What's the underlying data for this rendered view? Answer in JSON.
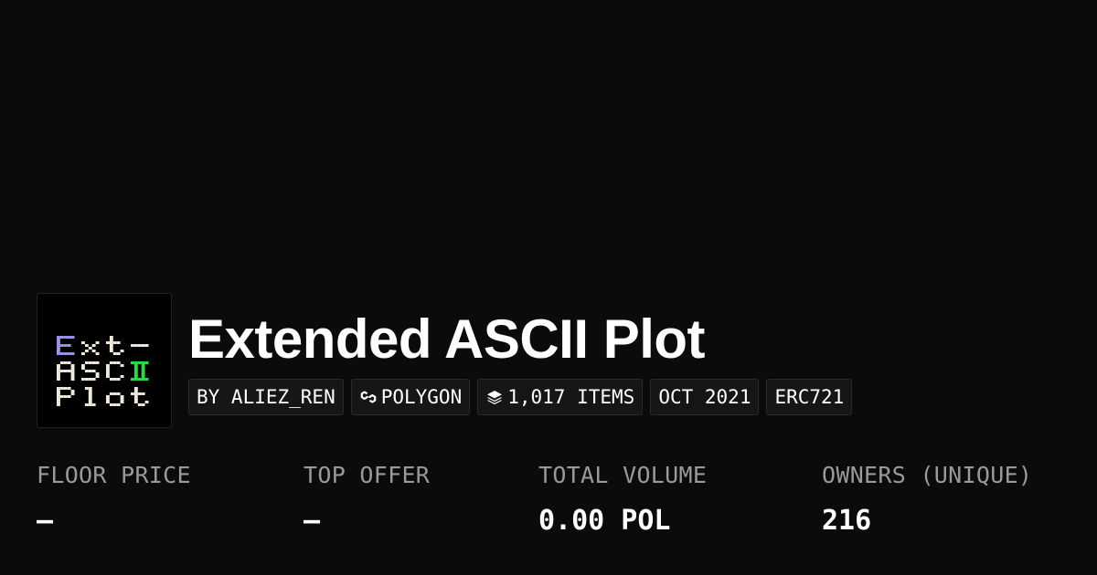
{
  "colors": {
    "background": "#0b0b0b",
    "chip_background": "#161616",
    "label": "#9a9a9a",
    "value": "#ffffff",
    "logo_green": "#2fd84a",
    "logo_lavender": "#9a94e4"
  },
  "collection": {
    "title": "Extended ASCII Plot",
    "logo": {
      "alt": "Extended ASCII Plot logo",
      "lines": [
        "Ext-",
        "ASCII",
        "Plot"
      ]
    }
  },
  "chips": [
    {
      "label": "BY ALIEZ_REN",
      "icon": null
    },
    {
      "label": "POLYGON",
      "icon": "polygon-chain-icon"
    },
    {
      "label": "1,017 ITEMS",
      "icon": "layers-icon"
    },
    {
      "label": "OCT 2021",
      "icon": null
    },
    {
      "label": "ERC721",
      "icon": null
    }
  ],
  "stats": [
    {
      "label": "FLOOR PRICE",
      "value": "–"
    },
    {
      "label": "TOP OFFER",
      "value": "–"
    },
    {
      "label": "TOTAL VOLUME",
      "value": "0.00 POL"
    },
    {
      "label": "OWNERS (UNIQUE)",
      "value": "216"
    }
  ]
}
